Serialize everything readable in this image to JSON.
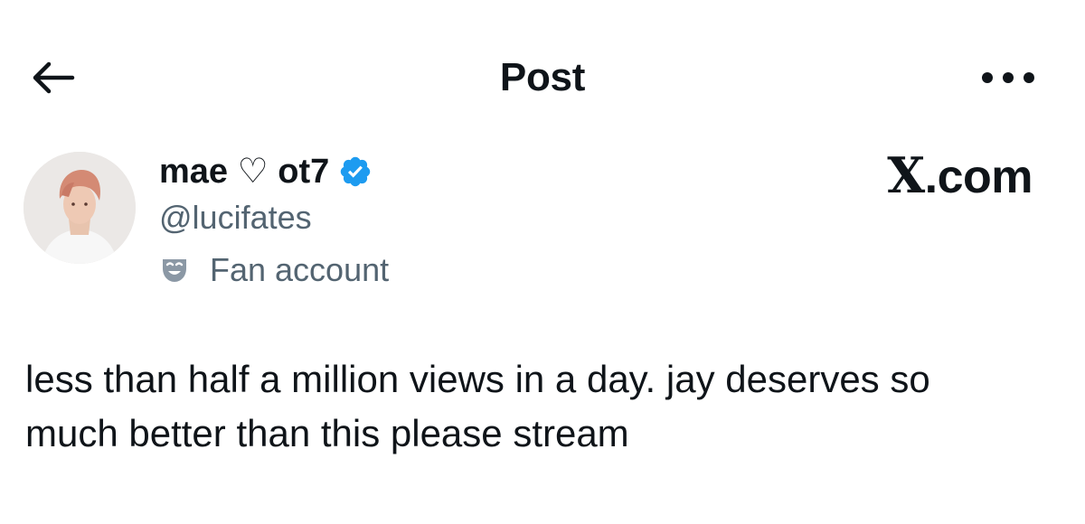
{
  "header": {
    "title": "Post",
    "back_icon": "arrow-left-icon",
    "more_icon": "more-horizontal-icon"
  },
  "author": {
    "display_name": "mae ♡ ot7",
    "handle": "@lucifates",
    "verified_icon": "verified-badge-icon",
    "verified_color": "#1d9bf0",
    "label_icon": "theater-masks-icon",
    "label": "Fan account"
  },
  "watermark": {
    "x": "X",
    "suffix": ".com"
  },
  "post": {
    "text": "less than half a million views in a day. jay deserves so\nmuch better than this please stream"
  },
  "colors": {
    "primary_text": "#0f1419",
    "secondary_text": "#536471",
    "background": "#ffffff"
  }
}
